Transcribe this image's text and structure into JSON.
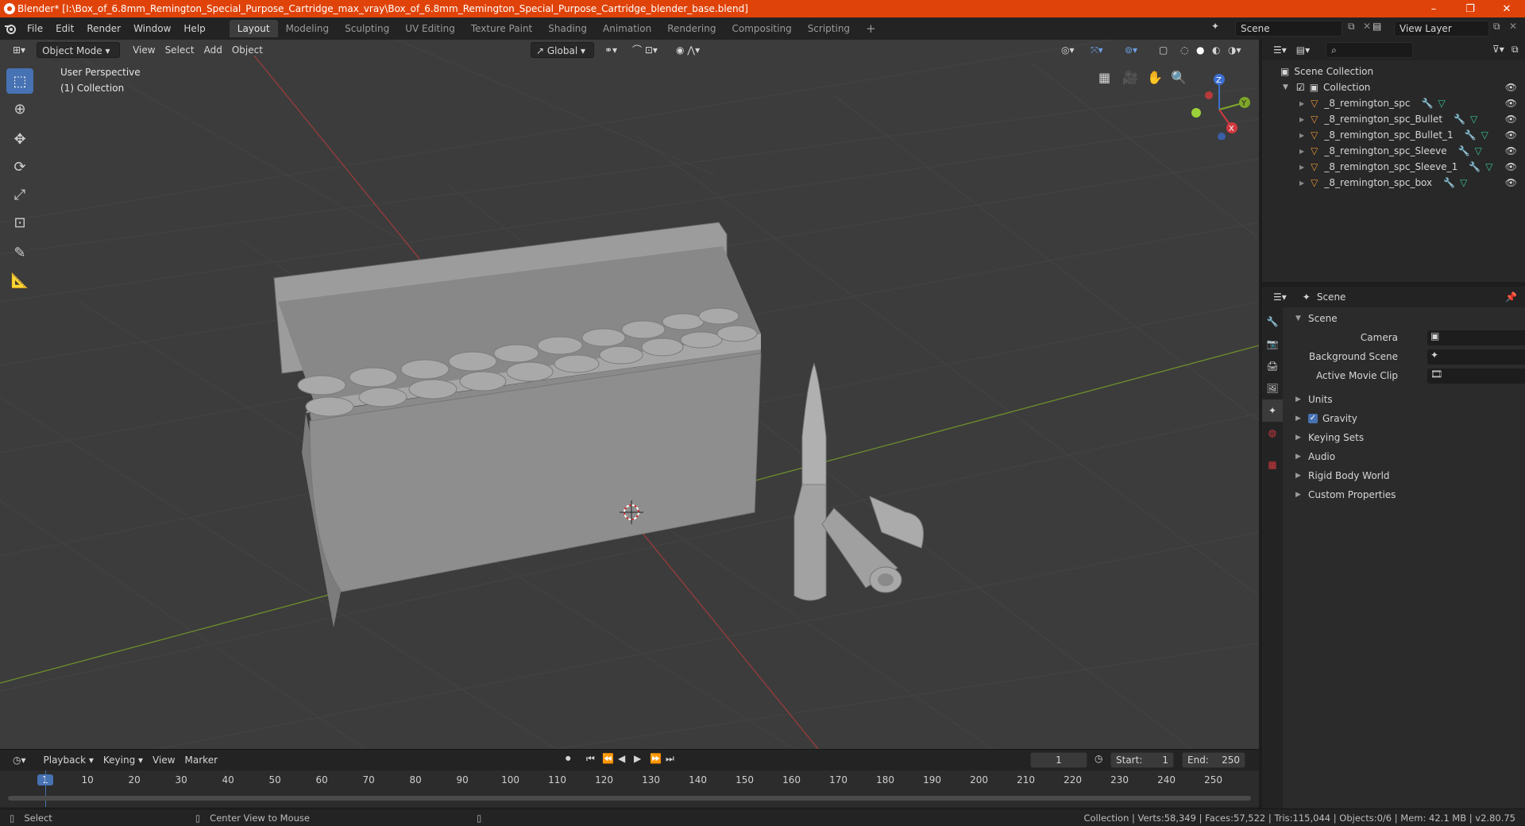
{
  "window": {
    "title": "Blender* [I:\\Box_of_6.8mm_Remington_Special_Purpose_Cartridge_max_vray\\Box_of_6.8mm_Remington_Special_Purpose_Cartridge_blender_base.blend]",
    "minimize": "–",
    "restore": "❐",
    "close": "✕"
  },
  "menu": [
    "File",
    "Edit",
    "Render",
    "Window",
    "Help"
  ],
  "workspaces": [
    "Layout",
    "Modeling",
    "Sculpting",
    "UV Editing",
    "Texture Paint",
    "Shading",
    "Animation",
    "Rendering",
    "Compositing",
    "Scripting"
  ],
  "add_workspace": "+",
  "scene_field": "Scene",
  "view_layer_field": "View Layer",
  "viewport": {
    "mode": "Object Mode",
    "menus": [
      "View",
      "Select",
      "Add",
      "Object"
    ],
    "transform_orientation": "Global",
    "overlay_title": "User Perspective",
    "overlay_collection": "(1) Collection",
    "gizmo": {
      "z": "Z",
      "y": "Y",
      "x": "X"
    }
  },
  "outliner": {
    "root": "Scene Collection",
    "collection": "Collection",
    "items": [
      "_8_remington_spc",
      "_8_remington_spc_Bullet",
      "_8_remington_spc_Bullet_1",
      "_8_remington_spc_Sleeve",
      "_8_remington_spc_Sleeve_1",
      "_8_remington_spc_box"
    ]
  },
  "properties": {
    "header": "Scene",
    "panel": "Scene",
    "camera_label": "Camera",
    "background_scene_label": "Background Scene",
    "active_movie_clip_label": "Active Movie Clip",
    "sections": [
      "Units",
      "Gravity",
      "Keying Sets",
      "Audio",
      "Rigid Body World",
      "Custom Properties"
    ],
    "gravity_checked": true
  },
  "timeline": {
    "menus": [
      "Playback",
      "Keying",
      "View",
      "Marker"
    ],
    "current_frame": "1",
    "start_label": "Start:",
    "start": "1",
    "end_label": "End:",
    "end": "250",
    "ticks": [
      "1",
      "10",
      "20",
      "30",
      "40",
      "50",
      "60",
      "70",
      "80",
      "90",
      "100",
      "110",
      "120",
      "130",
      "140",
      "150",
      "160",
      "170",
      "180",
      "190",
      "200",
      "210",
      "220",
      "230",
      "240",
      "250"
    ]
  },
  "status": {
    "select": "Select",
    "center_view": "Center View to Mouse",
    "stats": "Collection | Verts:58,349 | Faces:57,522 | Tris:115,044 | Objects:0/6 | Mem: 42.1 MB | v2.80.75"
  }
}
